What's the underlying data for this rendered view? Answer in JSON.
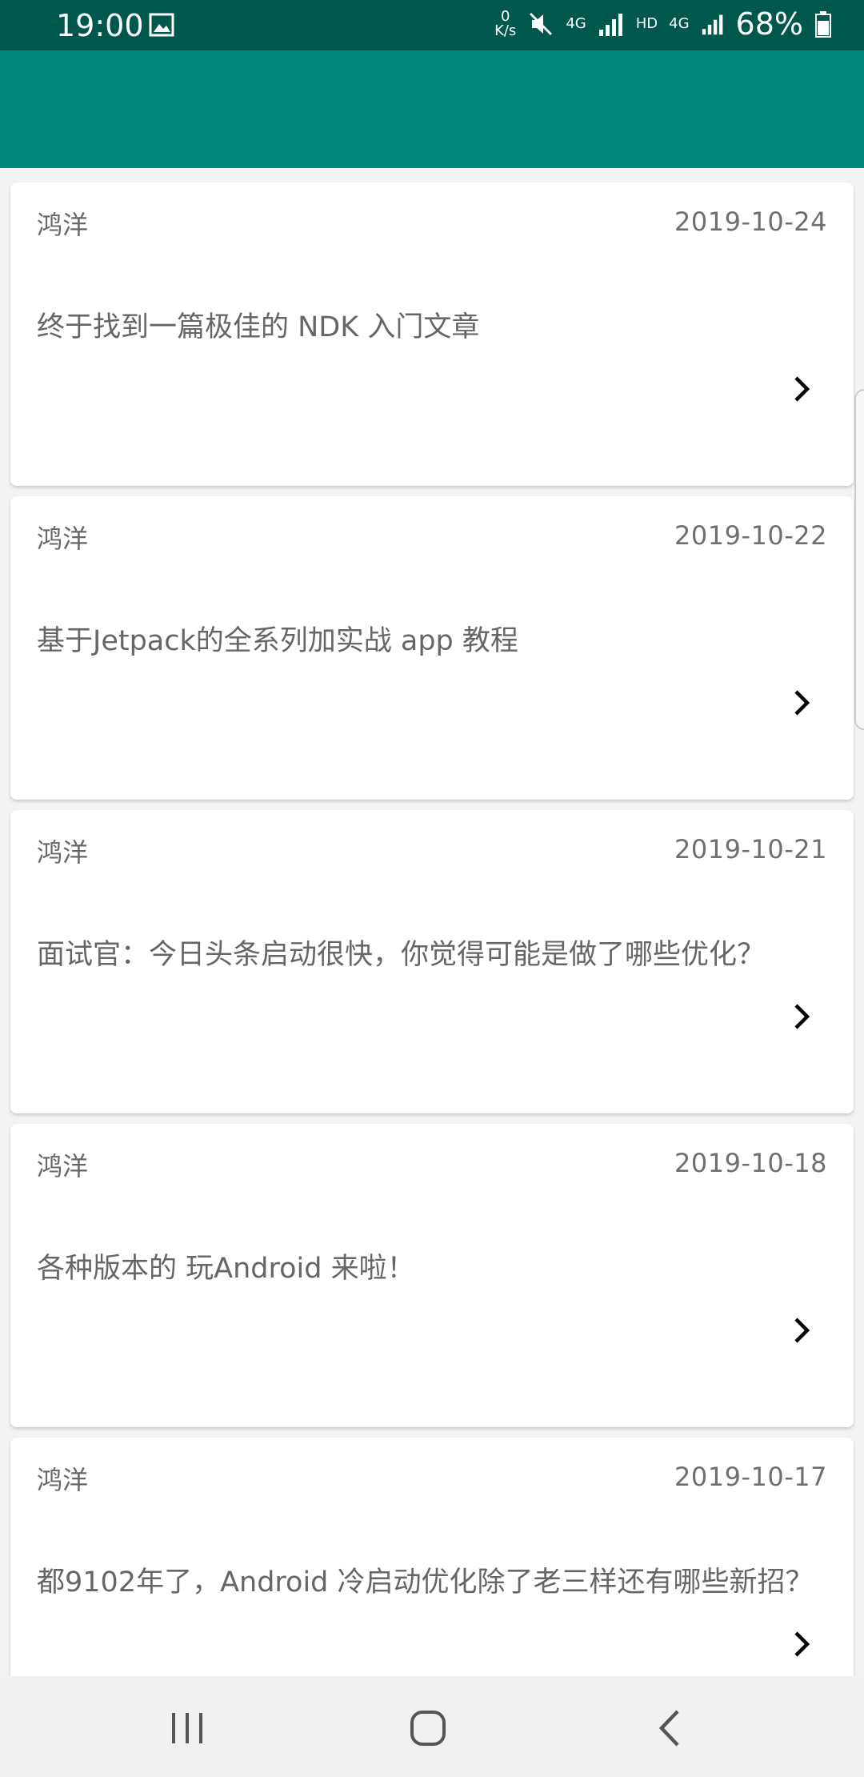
{
  "status_bar": {
    "time": "19:00",
    "net_speed_top": "0",
    "net_speed_bottom": "K/s",
    "network_4g": "4G",
    "hd_label": "HD",
    "network_4g_2": "4G",
    "battery": "68%",
    "icons": [
      "image-icon",
      "mute-icon",
      "signal-icon",
      "battery-icon"
    ]
  },
  "app_bar": {
    "color": "#00897b"
  },
  "articles": [
    {
      "author": "鸿洋",
      "date": "2019-10-24",
      "title": "终于找到一篇极佳的 NDK 入门文章"
    },
    {
      "author": "鸿洋",
      "date": "2019-10-22",
      "title": "基于Jetpack的全系列加实战 app 教程"
    },
    {
      "author": "鸿洋",
      "date": "2019-10-21",
      "title": "面试官：今日头条启动很快，你觉得可能是做了哪些优化？"
    },
    {
      "author": "鸿洋",
      "date": "2019-10-18",
      "title": "各种版本的 玩Android 来啦！"
    },
    {
      "author": "鸿洋",
      "date": "2019-10-17",
      "title": "都9102年了，Android 冷启动优化除了老三样还有哪些新招？"
    }
  ],
  "nav_bar": {
    "buttons": [
      "recents-icon",
      "home-icon",
      "back-icon"
    ]
  }
}
